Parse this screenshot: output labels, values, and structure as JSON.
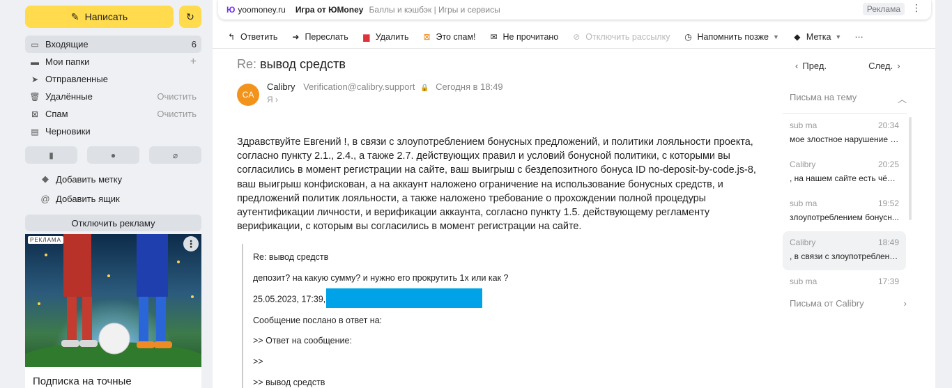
{
  "sidebar": {
    "compose_label": "Написать",
    "folders": [
      {
        "label": "Входящие",
        "count": "6",
        "icon": "inbox-icon"
      },
      {
        "label": "Мои папки",
        "action": "+",
        "icon": "folder-icon"
      },
      {
        "label": "Отправленные",
        "icon": "send-icon"
      },
      {
        "label": "Удалённые",
        "action": "Очистить",
        "icon": "trash-icon"
      },
      {
        "label": "Спам",
        "action": "Очистить",
        "icon": "spam-icon"
      },
      {
        "label": "Черновики",
        "icon": "drafts-icon"
      }
    ],
    "links": {
      "add_label": "Добавить метку",
      "add_mailbox": "Добавить ящик"
    },
    "disable_ads": "Отключить рекламу",
    "ad": {
      "badge": "РЕКЛАМА",
      "title": "Подписка на точные"
    }
  },
  "promo": {
    "site": "yoomoney.ru",
    "title": "Игра от ЮMoney",
    "description": "Баллы и кэшбэк | Игры и сервисы",
    "ad_label": "Реклама"
  },
  "toolbar": {
    "reply": "Ответить",
    "forward": "Переслать",
    "delete": "Удалить",
    "spam": "Это спам!",
    "unread": "Не прочитано",
    "unsubscribe": "Отключить рассылку",
    "remind": "Напомнить позже",
    "label": "Метка"
  },
  "message": {
    "subject_prefix": "Re:",
    "subject": "вывод средств",
    "avatar_initials": "CA",
    "sender_name": "Calibry",
    "sender_email": "Verification@calibry.support",
    "date": "Сегодня в 18:49",
    "to": "Я",
    "body": "Здравствуйте Евгений !, в связи с злоупотреблением бонусных предложений, и политики лояльности проекта, согласно пункту 2.1., 2.4., а также 2.7. действующих правил и условий бонусной политики, с которыми вы согласились в момент регистрации на сайте, ваш выигрыш с бездепозитного бонуса ID no-deposit-by-code.js-8, ваш выигрыш конфискован, а на аккаунт наложено ограничение на использование бонусных средств, и предложений политик лояльности, а также наложено требование о прохождении полной процедуры аутентификации личности, и верификации аккаунта, согласно пункту 1.5. действующему регламенту верификации, с которым вы согласились в момент регистрации на сайте.",
    "quote": {
      "subject": "Re: вывод средств",
      "question": "депозит? на какую сумму? и нужно его прокрутить 1х или как ?",
      "datetime": "25.05.2023, 17:39,",
      "reply_to": "Сообщение послано в ответ на:",
      "reply_msg": ">> Ответ на сообщение:",
      "blank": ">>",
      "subj": ">> вывод средств"
    }
  },
  "thread": {
    "prev": "Пред.",
    "next": "След.",
    "heading": "Письма на тему",
    "items": [
      {
        "sender": "sub ma",
        "time": "20:34",
        "snippet": "мое злостное нарушение п..."
      },
      {
        "sender": "Calibry",
        "time": "20:25",
        "snippet": ", на нашем сайте есть чётк..."
      },
      {
        "sender": "sub ma",
        "time": "19:52",
        "snippet": "злоупотреблением бонусн..."
      },
      {
        "sender": "Calibry",
        "time": "18:49",
        "snippet": ", в связи с злоупотребления..."
      },
      {
        "sender": "sub ma",
        "time": "17:39",
        "snippet": ""
      }
    ],
    "from_sender": "Письма от Calibry"
  },
  "colors": {
    "accent": "#ffdb4d",
    "avatar": "#f2931c",
    "redaction": "#00a3e8",
    "yoomoney": "#6b30ff"
  }
}
